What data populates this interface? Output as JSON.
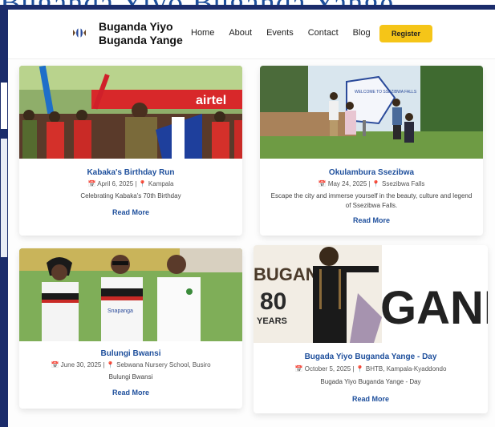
{
  "background": {
    "title": "Buganda Yiyo Buganda Yange"
  },
  "header": {
    "brand_line1": "Buganda Yiyo",
    "brand_line2": "Buganda Yange",
    "nav": [
      "Home",
      "About",
      "Events",
      "Contact",
      "Blog"
    ],
    "register_label": "Register"
  },
  "events": [
    {
      "title": "Kabaka's Birthday Run",
      "date": "April 6, 2025",
      "location": "Kampala",
      "description": "Celebrating Kabaka's 70th Birthday",
      "read_more": "Read More"
    },
    {
      "title": "Okulambura Ssezibwa",
      "date": "May 24, 2025",
      "location": "Ssezibwa Falls",
      "description": "Escape the city and immerse yourself in the beauty, culture and legend of Ssezibwa Falls.",
      "read_more": "Read More"
    },
    {
      "title": "Bulungi Bwansi",
      "date": "June 30, 2025",
      "location": "Sebwana Nursery School, Busiro",
      "description": "Bulungi Bwansi",
      "read_more": "Read More"
    },
    {
      "title": "Bugada Yiyo Buganda Yange - Day",
      "date": "October 5, 2025",
      "location": "BHTB, Kampala-Kyaddondo",
      "description": "Bugada Yiyo Buganda Yange - Day",
      "read_more": "Read More"
    }
  ],
  "photo_text": {
    "card1_banner": "airtel",
    "card2_sign": "WELCOME TO SSEZIBWA FALLS",
    "card3_shirt": "Snapanga",
    "card4_big": "GANDA",
    "card4_small1": "BUGAN",
    "card4_small2": "80",
    "card4_small3": "YEARS"
  },
  "colors": {
    "accent_blue": "#1e4f9c",
    "register_yellow": "#f5c518",
    "navy": "#1b2c6b"
  }
}
